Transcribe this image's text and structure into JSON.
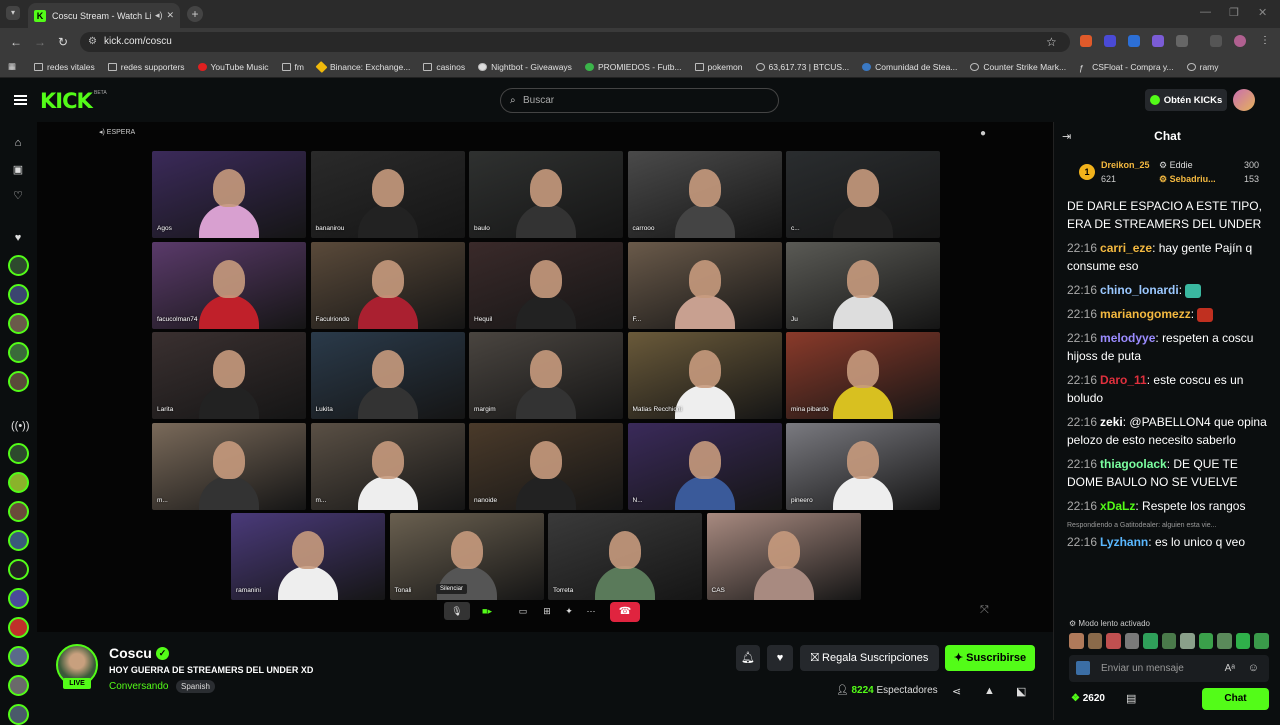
{
  "browser": {
    "tab_title": "Coscu Stream - Watch Live",
    "url": "kick.com/coscu",
    "bookmarks": [
      "redes vitales",
      "redes supporters",
      "YouTube Music",
      "fm",
      "Binance: Exchange...",
      "casinos",
      "Nightbot - Giveaways",
      "PROMIEDOS - Futb...",
      "pokemon",
      "63,617.73 | BTCUS...",
      "Comunidad de Stea...",
      "Counter Strike Mark...",
      "CSFloat - Compra y...",
      "ramy"
    ]
  },
  "header": {
    "logo": "KICK",
    "beta": "BETA",
    "search_placeholder": "Buscar",
    "get_kicks": "Obtén KICKs"
  },
  "player": {
    "status": "ESPERA",
    "tooltip": "Silenciar",
    "participants": [
      "Agos",
      "bananirou",
      "baulo",
      "carrooo",
      "c...",
      "facucolman74",
      "Faculriondo",
      "Hequil",
      "F...",
      "Ju",
      "Larita",
      "Lukita",
      "margim",
      "Matias Recchioni",
      "mina pibardo",
      "m...",
      "m...",
      "nanoide",
      "N...",
      "pineero",
      "ramanini",
      "Tonali",
      "Torreta",
      "CAS"
    ]
  },
  "channel": {
    "name": "Coscu",
    "live": "LIVE",
    "title": "HOY GUERRA DE STREAMERS DEL UNDER XD",
    "category": "Conversando",
    "language": "Spanish",
    "gift_subs": "Regala Suscripciones",
    "subscribe": "Suscribirse",
    "viewers_count": "8224",
    "viewers_label": "Espectadores"
  },
  "chat": {
    "title": "Chat",
    "pinned": [
      {
        "rank": "1",
        "user": "Dreikon_25",
        "value": "621"
      },
      {
        "user": "Eddie",
        "value": "300"
      },
      {
        "user": "Sebadriu...",
        "value": "153"
      }
    ],
    "partial_message": "DE DARLE ESPACIO A ESTE TIPO, ERA DE STREAMERS DEL UNDER",
    "messages": [
      {
        "time": "22:16",
        "user": "carri_eze",
        "color": "#f4b940",
        "text": "hay gente Pajín q consume eso"
      },
      {
        "time": "22:16",
        "user": "chino_lonardi",
        "color": "#9bc8ff",
        "text": ""
      },
      {
        "time": "22:16",
        "user": "marianogomezz",
        "color": "#f4b940",
        "text": ""
      },
      {
        "time": "22:16",
        "user": "melodyye",
        "color": "#9b8cff",
        "text": "respeten a coscu hijoss de puta"
      },
      {
        "time": "22:16",
        "user": "Daro_11",
        "color": "#e0303d",
        "text": "este coscu es un boludo"
      },
      {
        "time": "22:16",
        "user": "zeki",
        "color": "#ffffff",
        "text": "@PABELLON4 que opina pelozo de esto necesito saberlo"
      },
      {
        "time": "22:16",
        "user": "thiagoolack",
        "color": "#7bffa0",
        "text": "DE QUE TE DOME BAULO NO SE VUELVE"
      },
      {
        "time": "22:16",
        "user": "xDaLz",
        "color": "#53fc18",
        "text": "Respete los rangos"
      },
      {
        "time": "22:16",
        "user": "Lyzhann",
        "color": "#5ab8ff",
        "text": "es lo unico q veo"
      }
    ],
    "reply_note": "Respondiendo a Gatitodealer: alguien esta vie...",
    "slow_mode": "Modo lento activado",
    "input_placeholder": "Enviar un mensaje",
    "kicks_balance": "2620",
    "send": "Chat"
  }
}
